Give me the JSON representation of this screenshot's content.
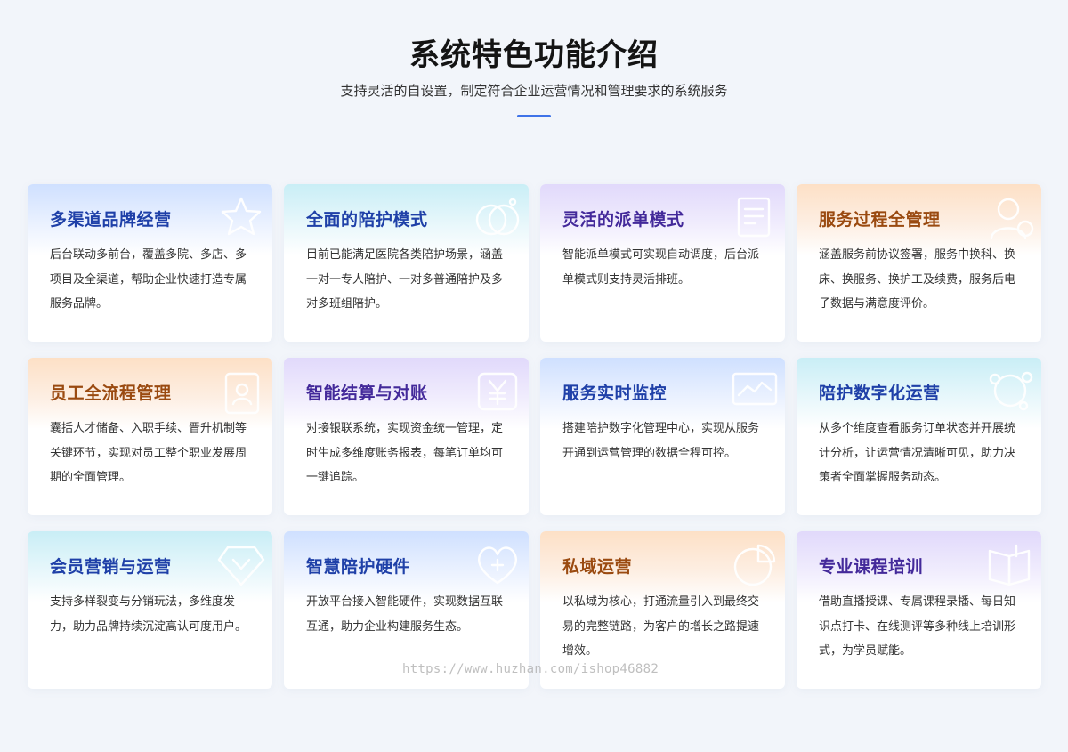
{
  "header": {
    "title": "系统特色功能介绍",
    "subtitle": "支持灵活的自设置，制定符合企业运营情况和管理要求的系统服务",
    "accent_color": "#3f73e8"
  },
  "cards": [
    {
      "title": "多渠道品牌经营",
      "desc": "后台联动多前台，覆盖多院、多店、多项目及全渠道，帮助企业快速打造专属服务品牌。",
      "theme": "blue",
      "icon": "star-icon"
    },
    {
      "title": "全面的陪护模式",
      "desc": "目前已能满足医院各类陪护场景，涵盖一对一专人陪护、一对多普通陪护及多对多班组陪护。",
      "theme": "cyan",
      "icon": "overlap-circles-icon"
    },
    {
      "title": "灵活的派单模式",
      "desc": "智能派单模式可实现自动调度，后台派单模式则支持灵活排班。",
      "theme": "purple",
      "icon": "document-icon"
    },
    {
      "title": "服务过程全管理",
      "desc": "涵盖服务前协议签署，服务中换科、换床、换服务、换护工及续费，服务后电子数据与满意度评价。",
      "theme": "orange",
      "icon": "user-check-icon"
    },
    {
      "title": "员工全流程管理",
      "desc": "囊括人才储备、入职手续、晋升机制等关键环节，实现对员工整个职业发展周期的全面管理。",
      "theme": "orange",
      "icon": "id-card-icon"
    },
    {
      "title": "智能结算与对账",
      "desc": "对接银联系统，实现资金统一管理，定时生成多维度账务报表，每笔订单均可一键追踪。",
      "theme": "purple",
      "icon": "yuan-icon"
    },
    {
      "title": "服务实时监控",
      "desc": "搭建陪护数字化管理中心，实现从服务开通到运营管理的数据全程可控。",
      "theme": "blue",
      "icon": "monitor-chart-icon"
    },
    {
      "title": "陪护数字化运营",
      "desc": "从多个维度查看服务订单状态并开展统计分析，让运营情况清晰可见，助力决策者全面掌握服务动态。",
      "theme": "cyan",
      "icon": "network-icon"
    },
    {
      "title": "会员营销与运营",
      "desc": "支持多样裂变与分销玩法，多维度发力，助力品牌持续沉淀高认可度用户。",
      "theme": "cyan",
      "icon": "diamond-icon"
    },
    {
      "title": "智慧陪护硬件",
      "desc": "开放平台接入智能硬件，实现数据互联互通，助力企业构建服务生态。",
      "theme": "blue",
      "icon": "heart-plus-icon"
    },
    {
      "title": "私域运营",
      "desc": "以私域为核心，打通流量引入到最终交易的完整链路，为客户的增长之路提速增效。",
      "theme": "orange",
      "icon": "pie-chart-icon"
    },
    {
      "title": "专业课程培训",
      "desc": "借助直播授课、专属课程录播、每日知识点打卡、在线测评等多种线上培训形式，为学员赋能。",
      "theme": "purple",
      "icon": "open-book-icon"
    }
  ],
  "watermark": "https://www.huzhan.com/ishop46882"
}
